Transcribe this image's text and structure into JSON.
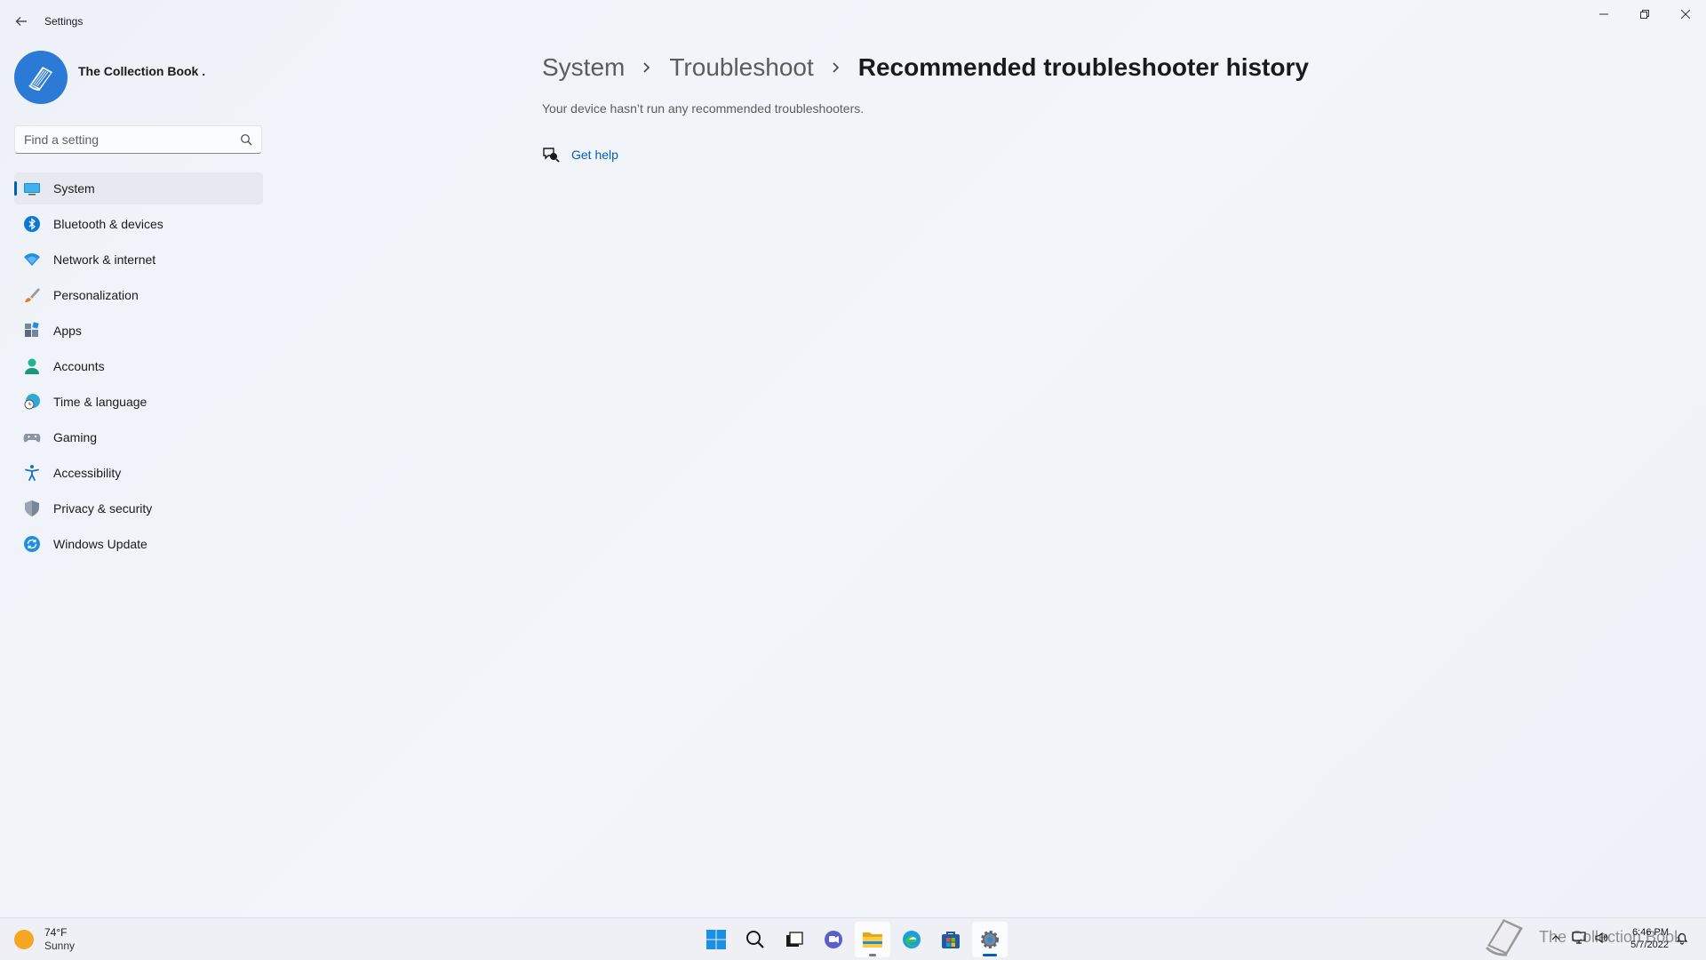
{
  "window": {
    "app_title": "Settings",
    "controls": {
      "minimize": "minimize",
      "maximize": "restore",
      "close": "close"
    }
  },
  "profile": {
    "name": "The Collection Book ."
  },
  "search": {
    "placeholder": "Find a setting",
    "value": ""
  },
  "sidebar": {
    "items": [
      {
        "label": "System",
        "icon": "system-icon",
        "active": true
      },
      {
        "label": "Bluetooth & devices",
        "icon": "bluetooth-icon"
      },
      {
        "label": "Network & internet",
        "icon": "wifi-icon"
      },
      {
        "label": "Personalization",
        "icon": "brush-icon"
      },
      {
        "label": "Apps",
        "icon": "apps-icon"
      },
      {
        "label": "Accounts",
        "icon": "account-icon"
      },
      {
        "label": "Time & language",
        "icon": "clock-globe-icon"
      },
      {
        "label": "Gaming",
        "icon": "gamepad-icon"
      },
      {
        "label": "Accessibility",
        "icon": "accessibility-icon"
      },
      {
        "label": "Privacy & security",
        "icon": "shield-icon"
      },
      {
        "label": "Windows Update",
        "icon": "update-icon"
      }
    ]
  },
  "main": {
    "breadcrumb": [
      {
        "label": "System"
      },
      {
        "label": "Troubleshoot"
      },
      {
        "label": "Recommended troubleshooter history"
      }
    ],
    "description": "Your device hasn’t run any recommended troubleshooters.",
    "get_help": "Get help"
  },
  "taskbar": {
    "weather": {
      "temp": "74°F",
      "condition": "Sunny"
    },
    "watermark": "The Collection Book",
    "clock": {
      "time": "6:46 PM",
      "date": "5/7/2022"
    }
  },
  "colors": {
    "accent": "#005fb8",
    "brand_blue": "#2b7bd6",
    "sun": "#f5a623"
  }
}
